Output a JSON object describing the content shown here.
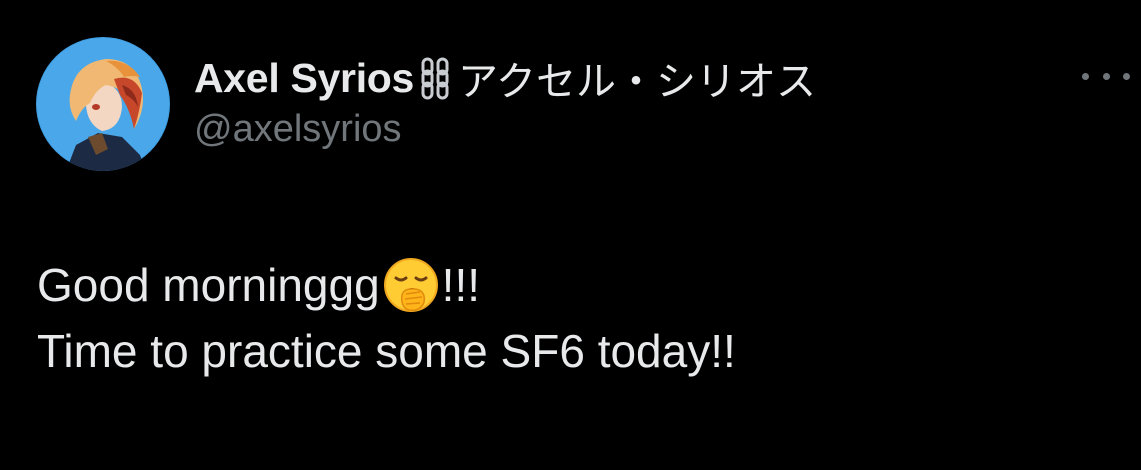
{
  "post": {
    "author": {
      "display_name": "Axel Syrios",
      "display_name_jp": "アクセル・シリオス",
      "handle": "@axelsyrios",
      "name_icon": "chain-link-icon",
      "avatar_icon": "avatar"
    },
    "more_icon": "more-options-icon",
    "body": {
      "line1_text": "Good morninggg",
      "line1_emoji": "yawning-face-emoji",
      "line1_suffix": "!!!",
      "line2_text": "Time to practice some SF6 today!!"
    }
  },
  "colors": {
    "background": "#000000",
    "primary_text": "#e7e9ea",
    "secondary_text": "#71767b"
  }
}
